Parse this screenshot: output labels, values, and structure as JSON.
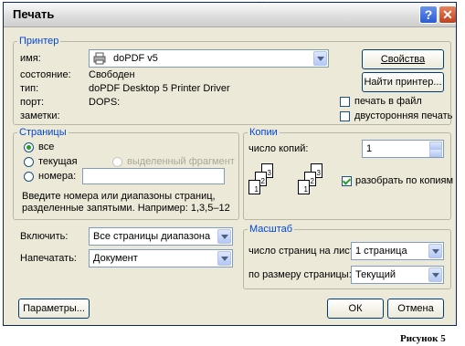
{
  "background_text": "...",
  "dialog": {
    "title": "Печать",
    "help_label": "?",
    "close_label": "✕"
  },
  "printer": {
    "legend": "Принтер",
    "name_label": "имя:",
    "name_value": "doPDF v5",
    "status_label": "состояние:",
    "status_value": "Свободен",
    "type_label": "тип:",
    "type_value": "doPDF  Desktop 5 Printer Driver",
    "port_label": "порт:",
    "port_value": "DOPS:",
    "notes_label": "заметки:",
    "properties_button": "Свойства",
    "find_printer_button": "Найти принтер...",
    "print_to_file_label": "печать в файл",
    "print_to_file_checked": false,
    "duplex_label": "двусторонняя печать",
    "duplex_checked": false
  },
  "pages": {
    "legend": "Страницы",
    "all_label": "все",
    "current_label": "текущая",
    "selection_label": "выделенный фрагмент",
    "numbers_label": "номера:",
    "numbers_value": "",
    "selected_option": "all",
    "hint_line1": "Введите номера или диапазоны страниц,",
    "hint_line2": "разделенные запятыми. Например: 1,3,5–12"
  },
  "copies": {
    "legend": "Копии",
    "count_label": "число копий:",
    "count_value": "1",
    "collate_label": "разобрать по копиям",
    "collate_checked": true,
    "collate_pages": [
      "3",
      "2",
      "1",
      "3",
      "2",
      "1"
    ]
  },
  "include": {
    "label": "Включить:",
    "value": "Все страницы диапазона"
  },
  "print_what": {
    "label": "Напечатать:",
    "value": "Документ"
  },
  "zoom": {
    "legend": "Масштаб",
    "pages_per_sheet_label": "число страниц на листе:",
    "pages_per_sheet_value": "1 страница",
    "scale_label": "по размеру страницы:",
    "scale_value": "Текущий"
  },
  "footer": {
    "options_button": "Параметры...",
    "ok_button": "ОК",
    "cancel_button": "Отмена"
  },
  "caption": "Рисунок 5"
}
